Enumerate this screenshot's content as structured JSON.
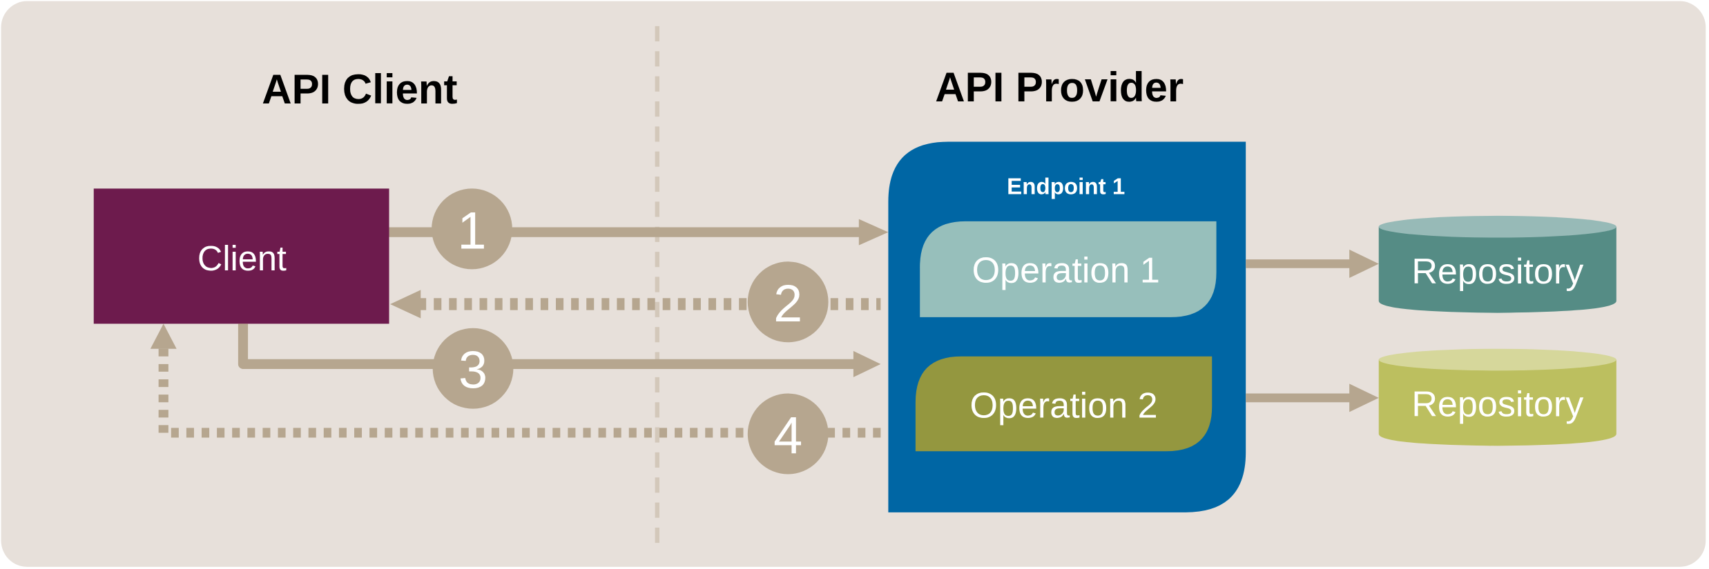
{
  "titles": {
    "left": "API Client",
    "right": "API Provider"
  },
  "client": {
    "label": "Client"
  },
  "endpoint": {
    "label": "Endpoint 1"
  },
  "operations": [
    {
      "label": "Operation 1"
    },
    {
      "label": "Operation 2"
    }
  ],
  "repositories": [
    {
      "label": "Repository"
    },
    {
      "label": "Repository"
    }
  ],
  "steps": [
    {
      "number": "1",
      "kind": "request"
    },
    {
      "number": "2",
      "kind": "response"
    },
    {
      "number": "3",
      "kind": "request"
    },
    {
      "number": "4",
      "kind": "response"
    }
  ],
  "colors": {
    "background": "#e7e0da",
    "client": "#6d1b4d",
    "endpoint": "#0066a4",
    "operation1": "#97bfbb",
    "operation2": "#94973f",
    "repo1_body": "#558c85",
    "repo1_top": "#97bab7",
    "repo2_body": "#bcbf5f",
    "repo2_top": "#d6d79b",
    "arrow": "#b6a68f",
    "divider": "#d3c8ba"
  }
}
